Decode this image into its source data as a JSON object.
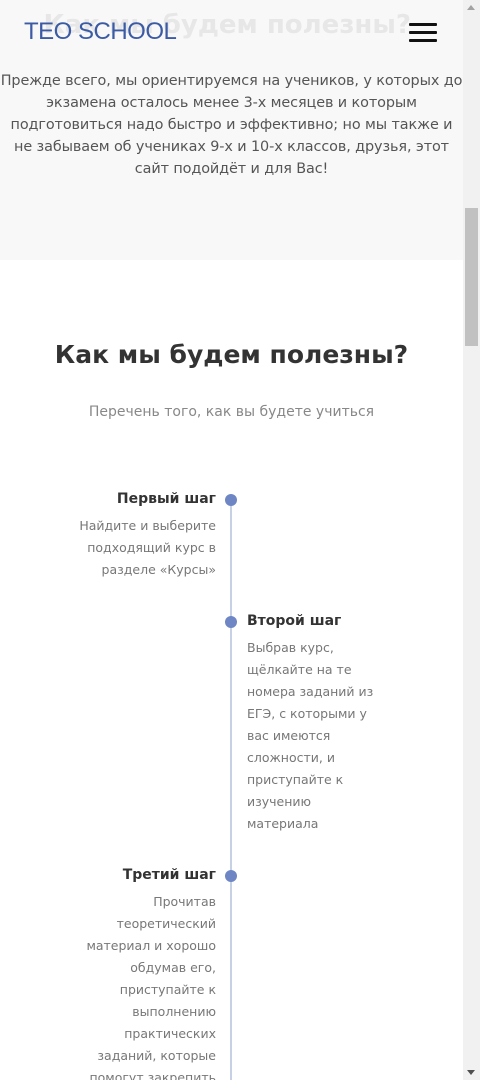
{
  "header": {
    "logo": "TEO SCHOOL",
    "menu_icon": "hamburger-menu-icon"
  },
  "intro": {
    "background_heading": "Как мы будем полезны?",
    "text": "Прежде всего, мы ориентируемся на учеников, у которых до экзамена осталось менее 3-х месяцев и которым подготовиться надо быстро и эффективно; но мы также и не забываем об учениках 9-х и 10-х классов, друзья, этот сайт подойдёт и для Вас!"
  },
  "section": {
    "title": "Как мы будем полезны?",
    "subtitle": "Перечень того, как вы будете учиться"
  },
  "steps": [
    {
      "title": "Первый шаг",
      "text": "Найдите и выберите подходящий курс в разделе «Курсы»"
    },
    {
      "title": "Второй шаг",
      "text": "Выбрав курс, щёлкайте на те номера заданий из ЕГЭ, с которыми у вас имеются сложности, и приступайте к изучению материала"
    },
    {
      "title": "Третий шаг",
      "text": "Прочитав теоретический материал и хорошо обдумав его, приступайте к выполнению практических заданий, которые помогут закрепить"
    }
  ],
  "colors": {
    "brand": "#3b5ba5",
    "timeline_dot": "#6e86c4",
    "timeline_line": "#c7d1e6",
    "intro_bg": "#f8f8f8"
  }
}
